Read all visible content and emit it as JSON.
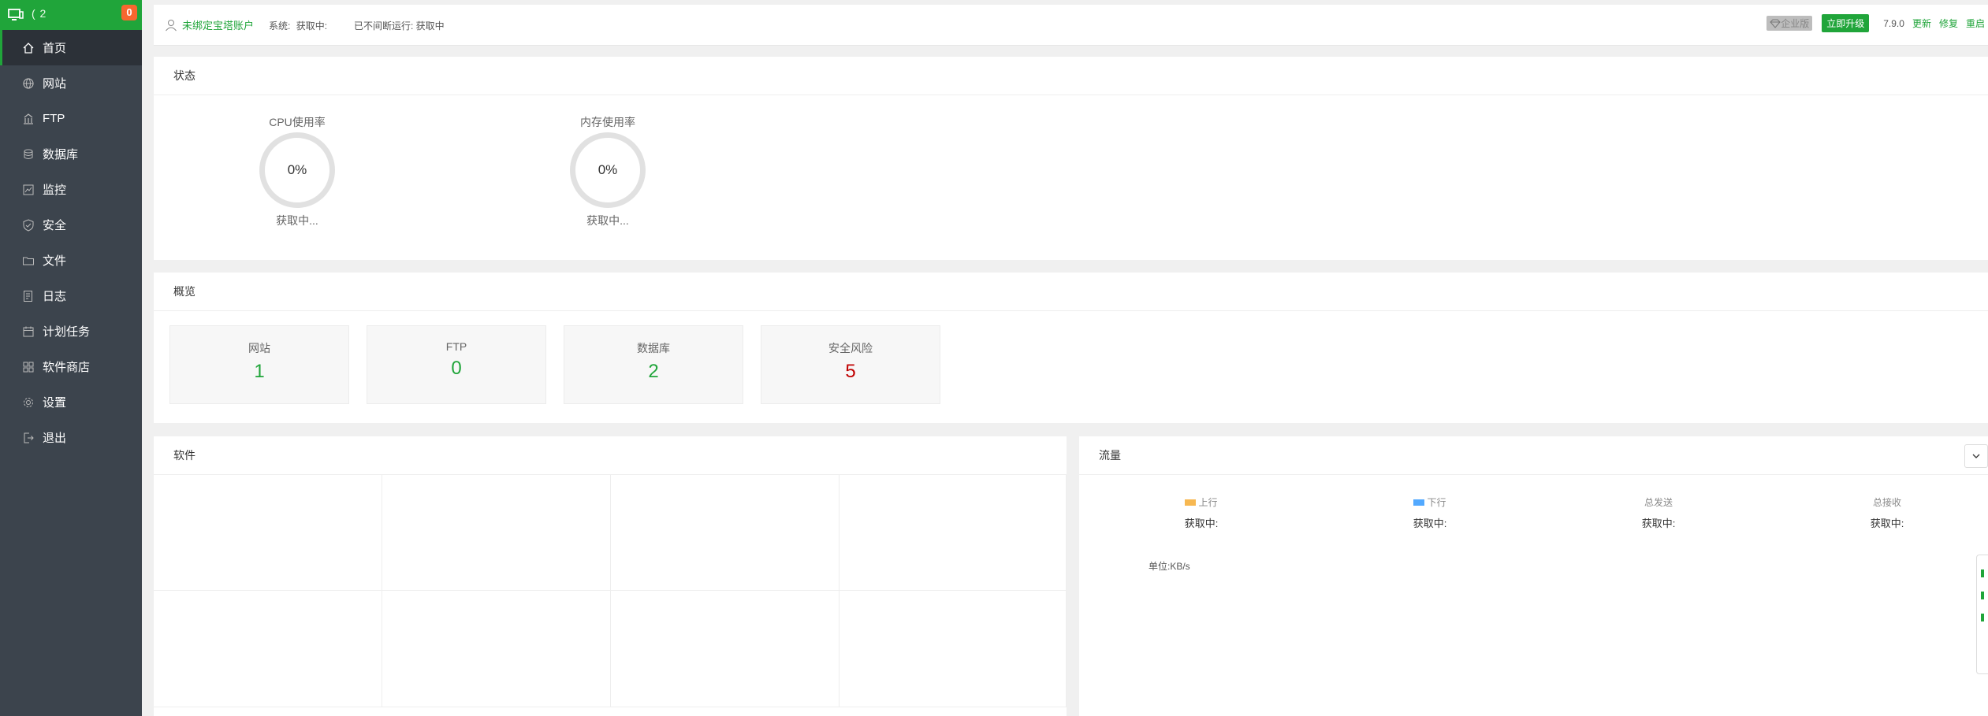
{
  "sidebar": {
    "host": "(          2",
    "badge": "0",
    "items": [
      {
        "label": "首页",
        "icon": "home-icon"
      },
      {
        "label": "网站",
        "icon": "globe-icon"
      },
      {
        "label": "FTP",
        "icon": "ftp-icon"
      },
      {
        "label": "数据库",
        "icon": "database-icon"
      },
      {
        "label": "监控",
        "icon": "monitor-icon"
      },
      {
        "label": "安全",
        "icon": "shield-icon"
      },
      {
        "label": "文件",
        "icon": "folder-icon"
      },
      {
        "label": "日志",
        "icon": "log-icon"
      },
      {
        "label": "计划任务",
        "icon": "calendar-icon"
      },
      {
        "label": "软件商店",
        "icon": "grid-icon"
      },
      {
        "label": "设置",
        "icon": "gear-icon"
      },
      {
        "label": "退出",
        "icon": "logout-icon"
      }
    ]
  },
  "topbar": {
    "user": "未绑定宝塔账户",
    "system_label": "系统:",
    "system_value": "获取中:",
    "uptime": "已不间断运行: 获取中",
    "enterprise": "企业版",
    "upgrade": "立即升级",
    "version": "7.9.0",
    "update": "更新",
    "repair": "修复",
    "restart": "重启"
  },
  "status": {
    "title": "状态",
    "cpu": {
      "label": "CPU使用率",
      "value": "0%",
      "sub": "获取中..."
    },
    "mem": {
      "label": "内存使用率",
      "value": "0%",
      "sub": "获取中..."
    }
  },
  "overview": {
    "title": "概览",
    "cards": [
      {
        "label": "网站",
        "value": "1",
        "color": "#20a53a"
      },
      {
        "label": "FTP",
        "value": "0",
        "color": "#20a53a"
      },
      {
        "label": "数据库",
        "value": "2",
        "color": "#20a53a"
      },
      {
        "label": "安全风险",
        "value": "5",
        "color": "#c00000"
      }
    ]
  },
  "software": {
    "title": "软件"
  },
  "traffic": {
    "title": "流量",
    "up": {
      "label": "上行",
      "value": "获取中:",
      "color": "#f7b851"
    },
    "down": {
      "label": "下行",
      "value": "获取中:",
      "color": "#52a9ff"
    },
    "sent": {
      "label": "总发送",
      "value": "获取中:"
    },
    "recv": {
      "label": "总接收",
      "value": "获取中:"
    },
    "unit": "单位:KB/s"
  },
  "colors": {
    "brand": "#20a53a",
    "sidebar": "#3c444d",
    "danger": "#c00000"
  }
}
